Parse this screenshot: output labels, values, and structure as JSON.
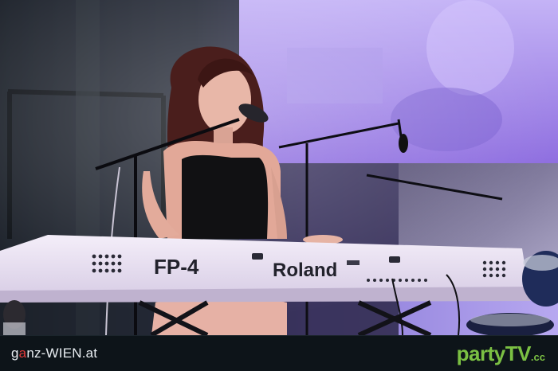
{
  "photo": {
    "keyboard_model": "FP-4",
    "keyboard_brand": "Roland"
  },
  "footer": {
    "left_brand": {
      "prefix": "g",
      "accent": "a",
      "rest": "nz-WIEN.at"
    },
    "right_brand": {
      "main": "partyTV",
      "suffix": ".cc"
    }
  },
  "colors": {
    "stage_purple": "#7a4fd6",
    "footer_bg": "#0d1419",
    "brand_red": "#e23a3a",
    "brand_green": "#7bc043"
  }
}
